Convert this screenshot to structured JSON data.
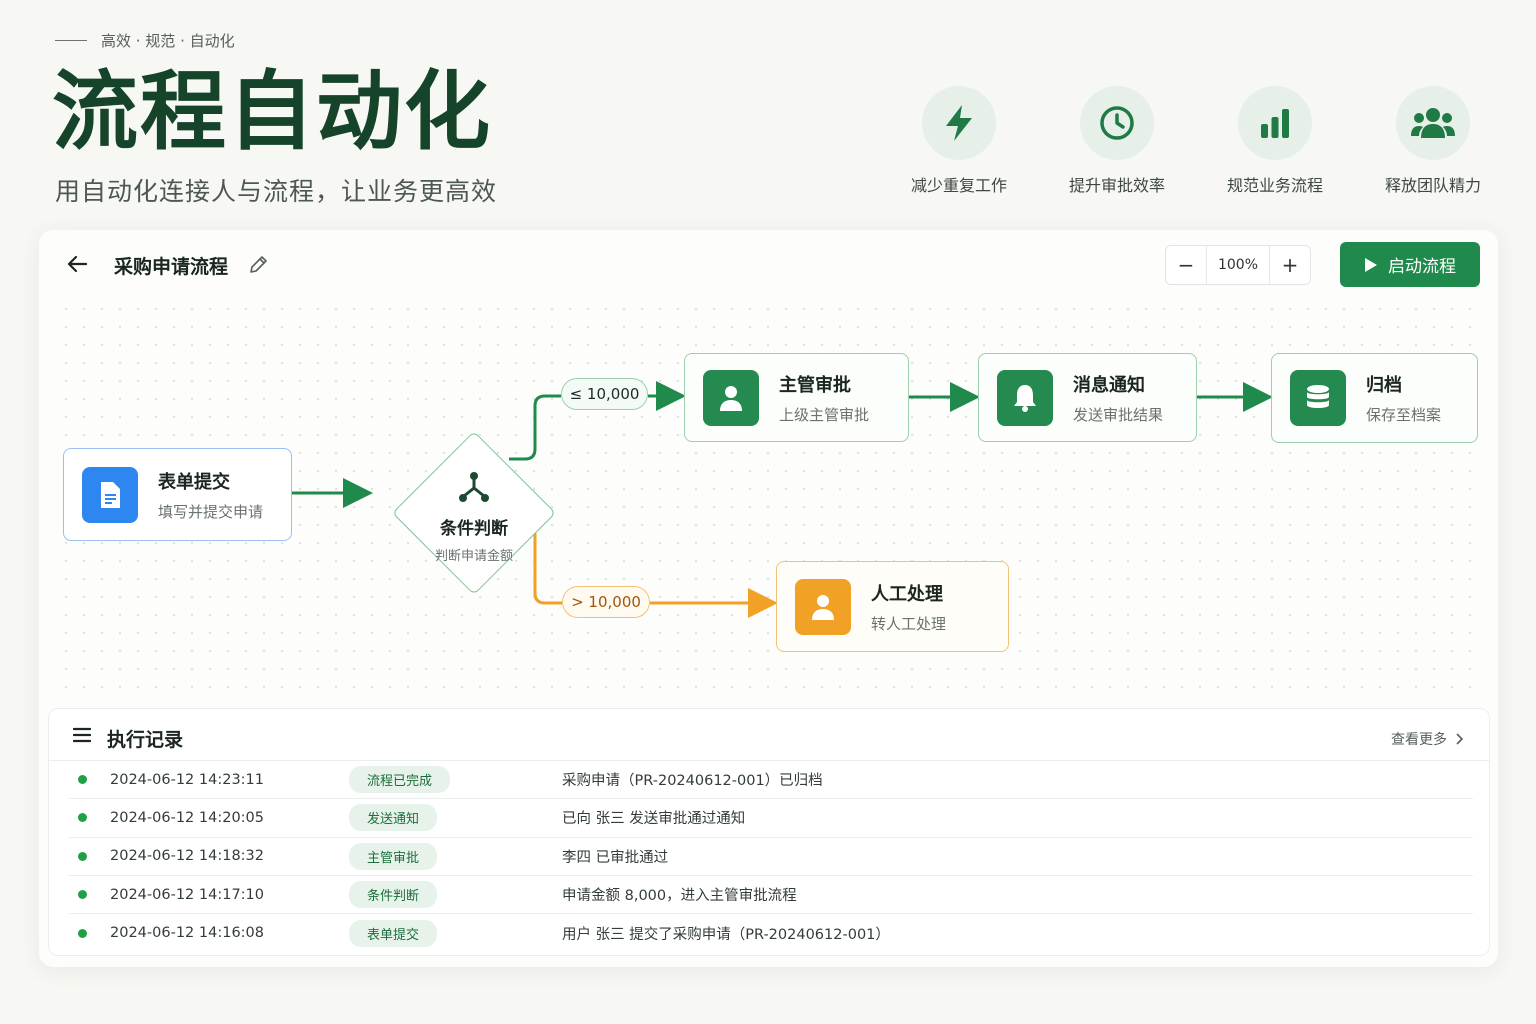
{
  "header": {
    "eyebrow": "高效 · 规范 · 自动化",
    "title": "流程自动化",
    "subtitle": "用自动化连接人与流程，让业务更高效"
  },
  "features": [
    {
      "label": "减少重复工作",
      "icon": "lightning-icon"
    },
    {
      "label": "提升审批效率",
      "icon": "clock-icon"
    },
    {
      "label": "规范业务流程",
      "icon": "bar-chart-icon"
    },
    {
      "label": "释放团队精力",
      "icon": "team-icon"
    }
  ],
  "toolbar": {
    "flow_name": "采购申请流程",
    "zoom": "100%",
    "zoom_out": "−",
    "zoom_in": "+",
    "start_label": "启动流程"
  },
  "flow": {
    "submit": {
      "title": "表单提交",
      "desc": "填写并提交申请"
    },
    "condition": {
      "title": "条件判断",
      "desc": "判断申请金额"
    },
    "branch_low": "≤ 10,000",
    "branch_high": "> 10,000",
    "approve": {
      "title": "主管审批",
      "desc": "上级主管审批"
    },
    "notify": {
      "title": "消息通知",
      "desc": "发送审批结果"
    },
    "archive": {
      "title": "归档",
      "desc": "保存至档案"
    },
    "manual": {
      "title": "人工处理",
      "desc": "转人工处理"
    }
  },
  "records": {
    "title": "执行记录",
    "more": "查看更多",
    "rows": [
      {
        "time": "2024-06-12  14:23:11",
        "tag": "流程已完成",
        "desc": "采购申请（PR-20240612-001）已归档"
      },
      {
        "time": "2024-06-12  14:20:05",
        "tag": "发送通知",
        "desc": "已向 张三 发送审批通过通知"
      },
      {
        "time": "2024-06-12  14:18:32",
        "tag": "主管审批",
        "desc": "李四 已审批通过"
      },
      {
        "time": "2024-06-12  14:17:10",
        "tag": "条件判断",
        "desc": "申请金额 8,000，进入主管审批流程"
      },
      {
        "time": "2024-06-12  14:16:08",
        "tag": "表单提交",
        "desc": "用户 张三 提交了采购申请（PR-20240612-001）"
      }
    ]
  },
  "colors": {
    "brand_green": "#1f8a4c",
    "title_green": "#15442a",
    "blue": "#2e86f0",
    "orange": "#f0a126",
    "status_dot": "#1fa046"
  }
}
